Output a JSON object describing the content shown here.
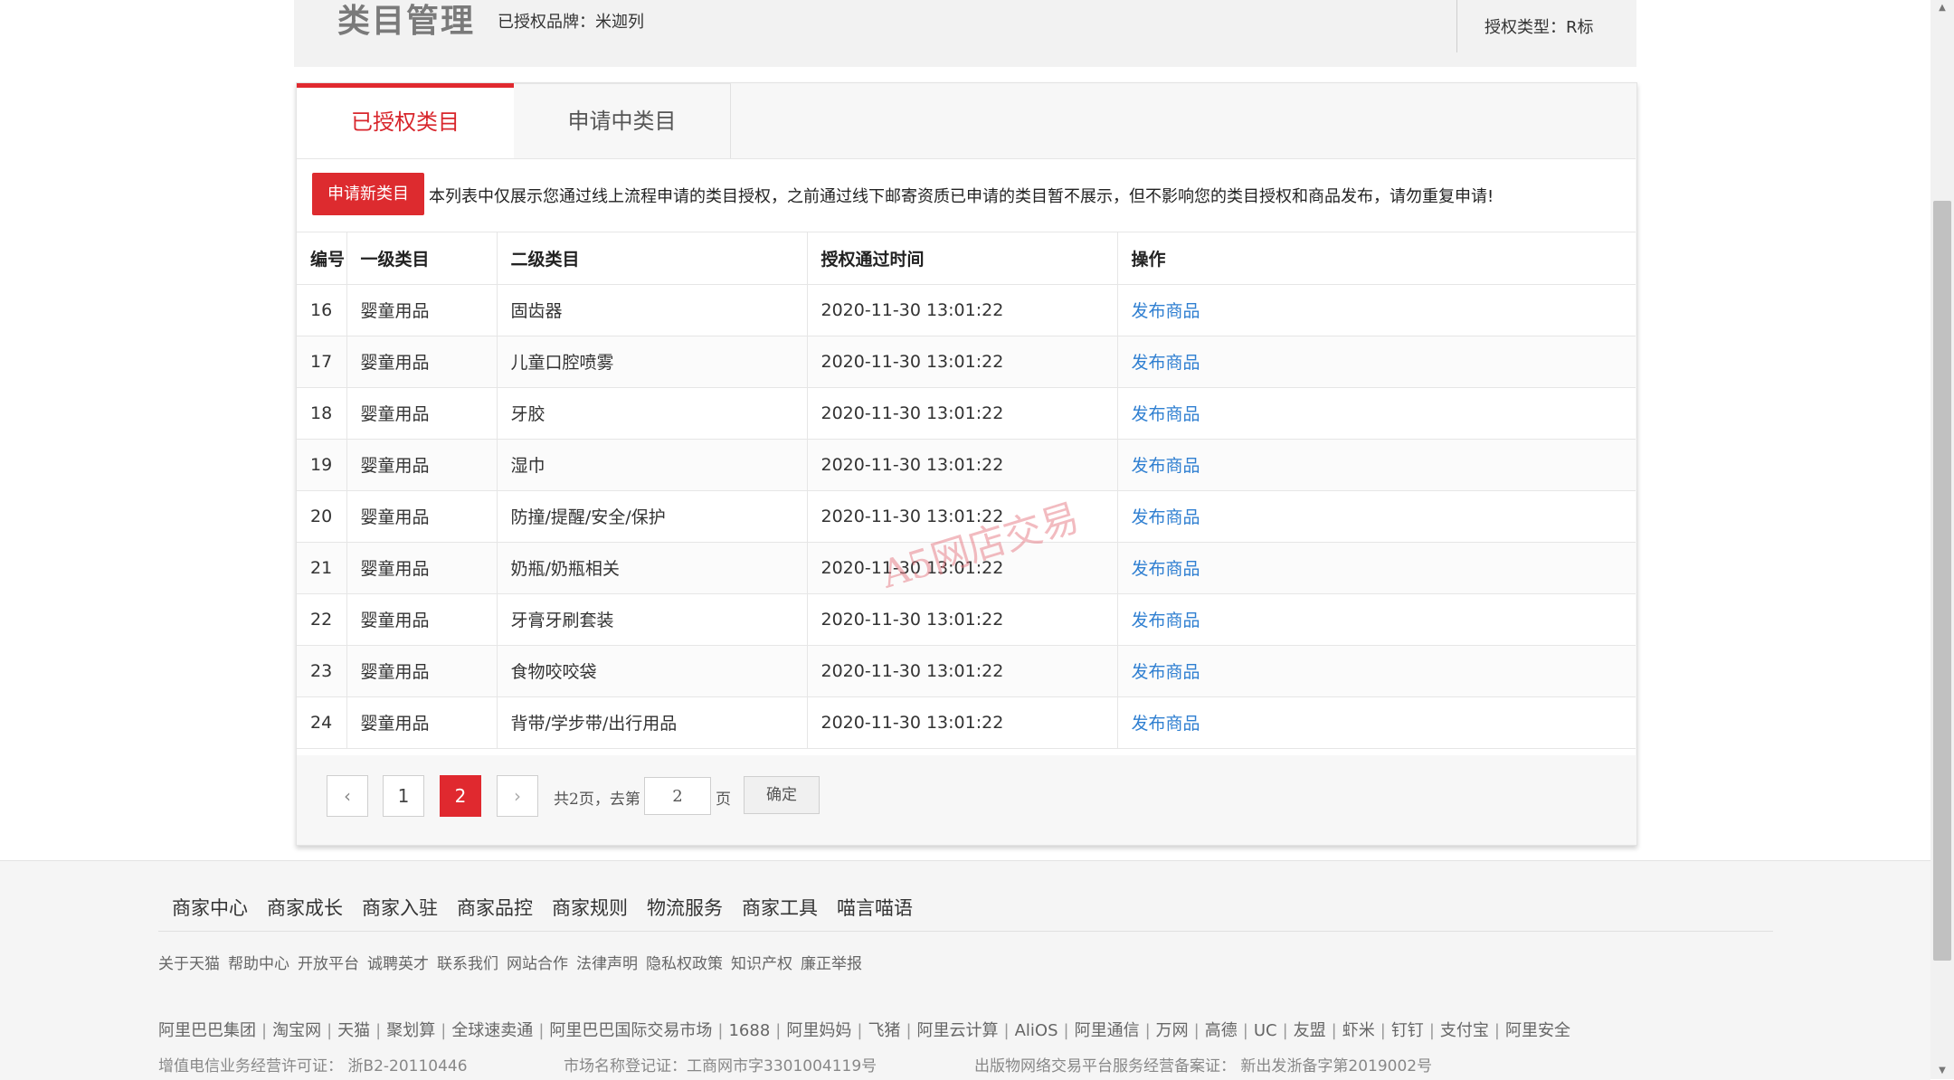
{
  "header": {
    "title": "类目管理",
    "brand_label": "已授权品牌：米迦列",
    "auth_type_label": "授权类型：R标"
  },
  "tabs": [
    {
      "label": "已授权类目",
      "active": true
    },
    {
      "label": "申请中类目",
      "active": false
    }
  ],
  "notice": {
    "apply_button": "申请新类目",
    "text": "本列表中仅展示您通过线上流程申请的类目授权，之前通过线下邮寄资质已申请的类目暂不展示，但不影响您的类目授权和商品发布，请勿重复申请!"
  },
  "table": {
    "columns": [
      "编号",
      "一级类目",
      "二级类目",
      "授权通过时间",
      "操作"
    ],
    "rows": [
      {
        "id": "16",
        "cat1": "婴童用品",
        "cat2": "固齿器",
        "time": "2020-11-30 13:01:22",
        "action": "发布商品"
      },
      {
        "id": "17",
        "cat1": "婴童用品",
        "cat2": "儿童口腔喷雾",
        "time": "2020-11-30 13:01:22",
        "action": "发布商品"
      },
      {
        "id": "18",
        "cat1": "婴童用品",
        "cat2": "牙胶",
        "time": "2020-11-30 13:01:22",
        "action": "发布商品"
      },
      {
        "id": "19",
        "cat1": "婴童用品",
        "cat2": "湿巾",
        "time": "2020-11-30 13:01:22",
        "action": "发布商品"
      },
      {
        "id": "20",
        "cat1": "婴童用品",
        "cat2": "防撞/提醒/安全/保护",
        "time": "2020-11-30 13:01:22",
        "action": "发布商品"
      },
      {
        "id": "21",
        "cat1": "婴童用品",
        "cat2": "奶瓶/奶瓶相关",
        "time": "2020-11-30 13:01:22",
        "action": "发布商品"
      },
      {
        "id": "22",
        "cat1": "婴童用品",
        "cat2": "牙膏牙刷套装",
        "time": "2020-11-30 13:01:22",
        "action": "发布商品"
      },
      {
        "id": "23",
        "cat1": "婴童用品",
        "cat2": "食物咬咬袋",
        "time": "2020-11-30 13:01:22",
        "action": "发布商品"
      },
      {
        "id": "24",
        "cat1": "婴童用品",
        "cat2": "背带/学步带/出行用品",
        "time": "2020-11-30 13:01:22",
        "action": "发布商品"
      }
    ]
  },
  "pagination": {
    "prev": "‹",
    "next": "›",
    "pages": [
      "1",
      "2"
    ],
    "current": "2",
    "total_text": "共2页，去第",
    "input_value": "2",
    "page_suffix": "页",
    "confirm": "确定"
  },
  "watermark": "A5网店交易",
  "footer": {
    "nav": [
      "商家中心",
      "商家成长",
      "商家入驻",
      "商家品控",
      "商家规则",
      "物流服务",
      "商家工具",
      "喵言喵语"
    ],
    "links": [
      "关于天猫",
      "帮助中心",
      "开放平台",
      "诚聘英才",
      "联系我们",
      "网站合作",
      "法律声明",
      "隐私权政策",
      "知识产权",
      "廉正举报"
    ],
    "group": [
      "阿里巴巴集团",
      "淘宝网",
      "天猫",
      "聚划算",
      "全球速卖通",
      "阿里巴巴国际交易市场",
      "1688",
      "阿里妈妈",
      "飞猪",
      "阿里云计算",
      "AliOS",
      "阿里通信",
      "万网",
      "高德",
      "UC",
      "友盟",
      "虾米",
      "钉钉",
      "支付宝",
      "阿里安全"
    ],
    "license1": "增值电信业务经营许可证： 浙B2-20110446",
    "license2": "市场名称登记证：工商网市字3301004119号",
    "license3": "出版物网络交易平台服务经营备案证： 新出发浙备字第2019002号"
  }
}
